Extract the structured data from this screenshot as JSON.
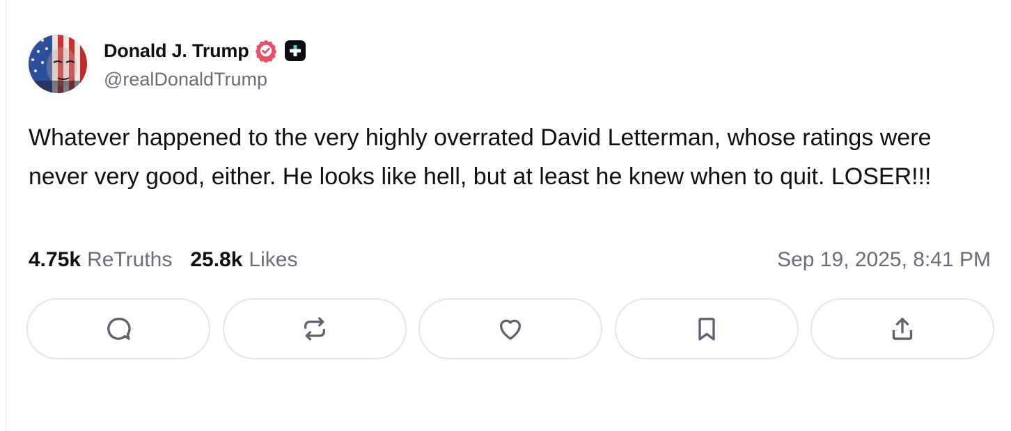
{
  "author": {
    "display_name": "Donald J. Trump",
    "handle": "@realDonaldTrump",
    "verified_badge_color": "#e8506a",
    "plus_badge_color": "#0d0d14"
  },
  "post": {
    "text": "Whatever happened to the very highly overrated David Letterman, whose ratings were never very good, either. He looks like hell, but at least he knew when to quit. LOSER!!!"
  },
  "stats": {
    "retruths_count": "4.75k",
    "retruths_label": "ReTruths",
    "likes_count": "25.8k",
    "likes_label": "Likes"
  },
  "timestamp": "Sep 19, 2025, 8:41 PM",
  "actions": [
    {
      "name": "reply",
      "icon": "reply-icon"
    },
    {
      "name": "retruth",
      "icon": "repost-icon"
    },
    {
      "name": "like",
      "icon": "heart-icon"
    },
    {
      "name": "bookmark",
      "icon": "bookmark-icon"
    },
    {
      "name": "share",
      "icon": "share-icon"
    }
  ]
}
